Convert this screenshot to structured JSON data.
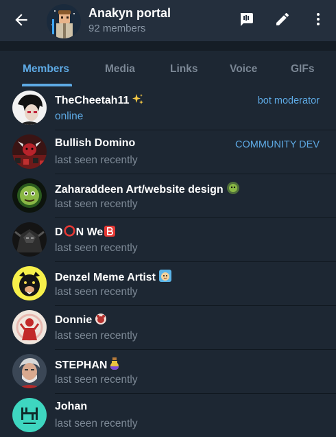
{
  "header": {
    "title": "Anakyn portal",
    "subtitle": "92 members"
  },
  "tabs": [
    {
      "label": "Members",
      "active": true
    },
    {
      "label": "Media",
      "active": false
    },
    {
      "label": "Links",
      "active": false
    },
    {
      "label": "Voice",
      "active": false
    },
    {
      "label": "GIFs",
      "active": false
    }
  ],
  "members": [
    {
      "name": "TheCheetah11",
      "status": "online",
      "role": "bot moderator",
      "emoji": "sparkles-icon"
    },
    {
      "name": "Bullish Domino",
      "status": "last seen recently",
      "role": "COMMUNITY DEV"
    },
    {
      "name": "Zaharaddeen Art/website design",
      "status": "last seen recently",
      "role": "",
      "emoji": "frog-sticker-icon"
    },
    {
      "name_parts": [
        "D",
        "N We"
      ],
      "status": "last seen recently",
      "role": "",
      "emoji": "b-button-icon",
      "inline_emoji": "red-circle-icon"
    },
    {
      "name": "Denzel Meme Artist",
      "status": "last seen recently",
      "role": "",
      "emoji": "cartoon-sticker-icon"
    },
    {
      "name": "Donnie",
      "status": "last seen recently",
      "role": "",
      "emoji": "bear-sticker-icon"
    },
    {
      "name": "STEPHAN",
      "status": "last seen recently",
      "role": "",
      "emoji": "potion-icon"
    },
    {
      "name": "Johan",
      "status": "last seen recently",
      "role": ""
    }
  ],
  "colors": {
    "accent": "#5eaae5",
    "background": "#1d2733",
    "header": "#242f3d",
    "muted": "#7d8996"
  }
}
